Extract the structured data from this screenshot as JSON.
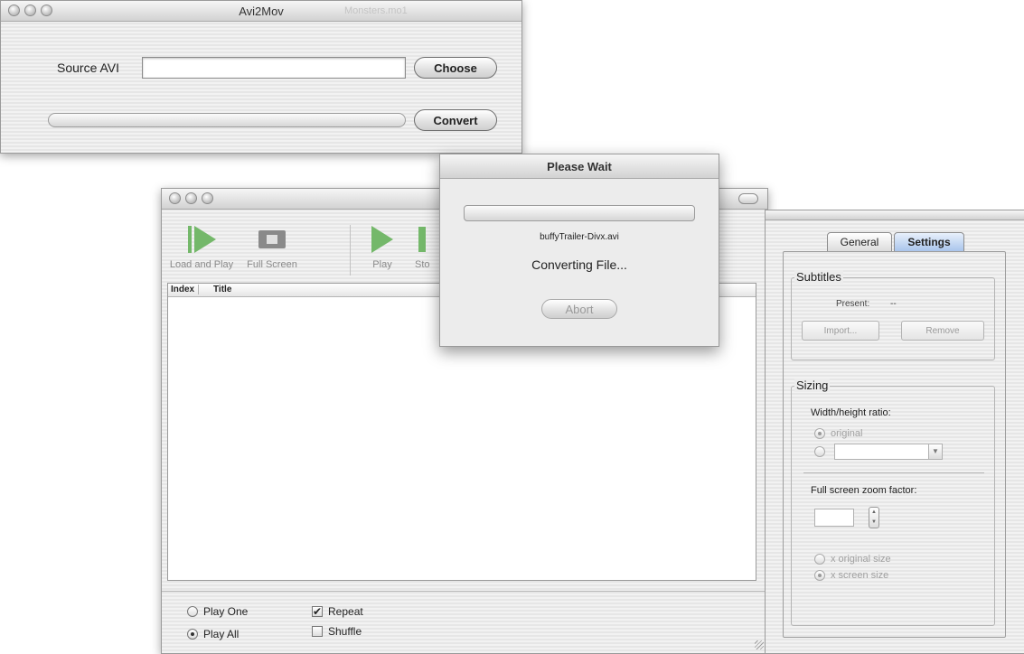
{
  "avi2mov": {
    "title": "Avi2Mov",
    "ghost_title": "Monsters.mo1",
    "source_label": "Source AVI",
    "source_value": "",
    "choose_label": "Choose",
    "convert_label": "Convert",
    "convert_progress": 0
  },
  "player": {
    "toolbar": [
      {
        "label": "Load and Play",
        "icon": "load-and-play-icon"
      },
      {
        "label": "Full Screen",
        "icon": "full-screen-icon"
      },
      {
        "label": "Play",
        "icon": "play-icon"
      },
      {
        "label": "Sto",
        "icon": "stop-icon"
      }
    ],
    "columns": [
      "Index",
      "Title"
    ],
    "rows": [],
    "play_one_label": "Play One",
    "play_all_label": "Play All",
    "play_mode": "Play All",
    "repeat_label": "Repeat",
    "repeat_checked": true,
    "shuffle_label": "Shuffle",
    "shuffle_checked": false
  },
  "please_wait": {
    "title": "Please Wait",
    "file_name": "buffyTrailer-Divx.avi",
    "status": "Converting File...",
    "abort_label": "Abort",
    "progress": 0
  },
  "prefs": {
    "tabs": [
      "General",
      "Settings"
    ],
    "active_tab": "Settings",
    "subtitles": {
      "title": "Subtitles",
      "present_label": "Present:",
      "present_value": "--",
      "import_label": "Import...",
      "remove_label": "Remove"
    },
    "sizing": {
      "title": "Sizing",
      "ratio_label": "Width/height ratio:",
      "ratio_original_label": "original",
      "ratio_selected": "original",
      "zoom_label": "Full screen zoom factor:",
      "zoom_value": "",
      "zoom_original_label": "x original size",
      "zoom_screen_label": "x screen size",
      "zoom_selected": "x screen size"
    }
  },
  "colors": {
    "accent_play": "#74b86a",
    "tab_active": "#a9c5ec"
  }
}
